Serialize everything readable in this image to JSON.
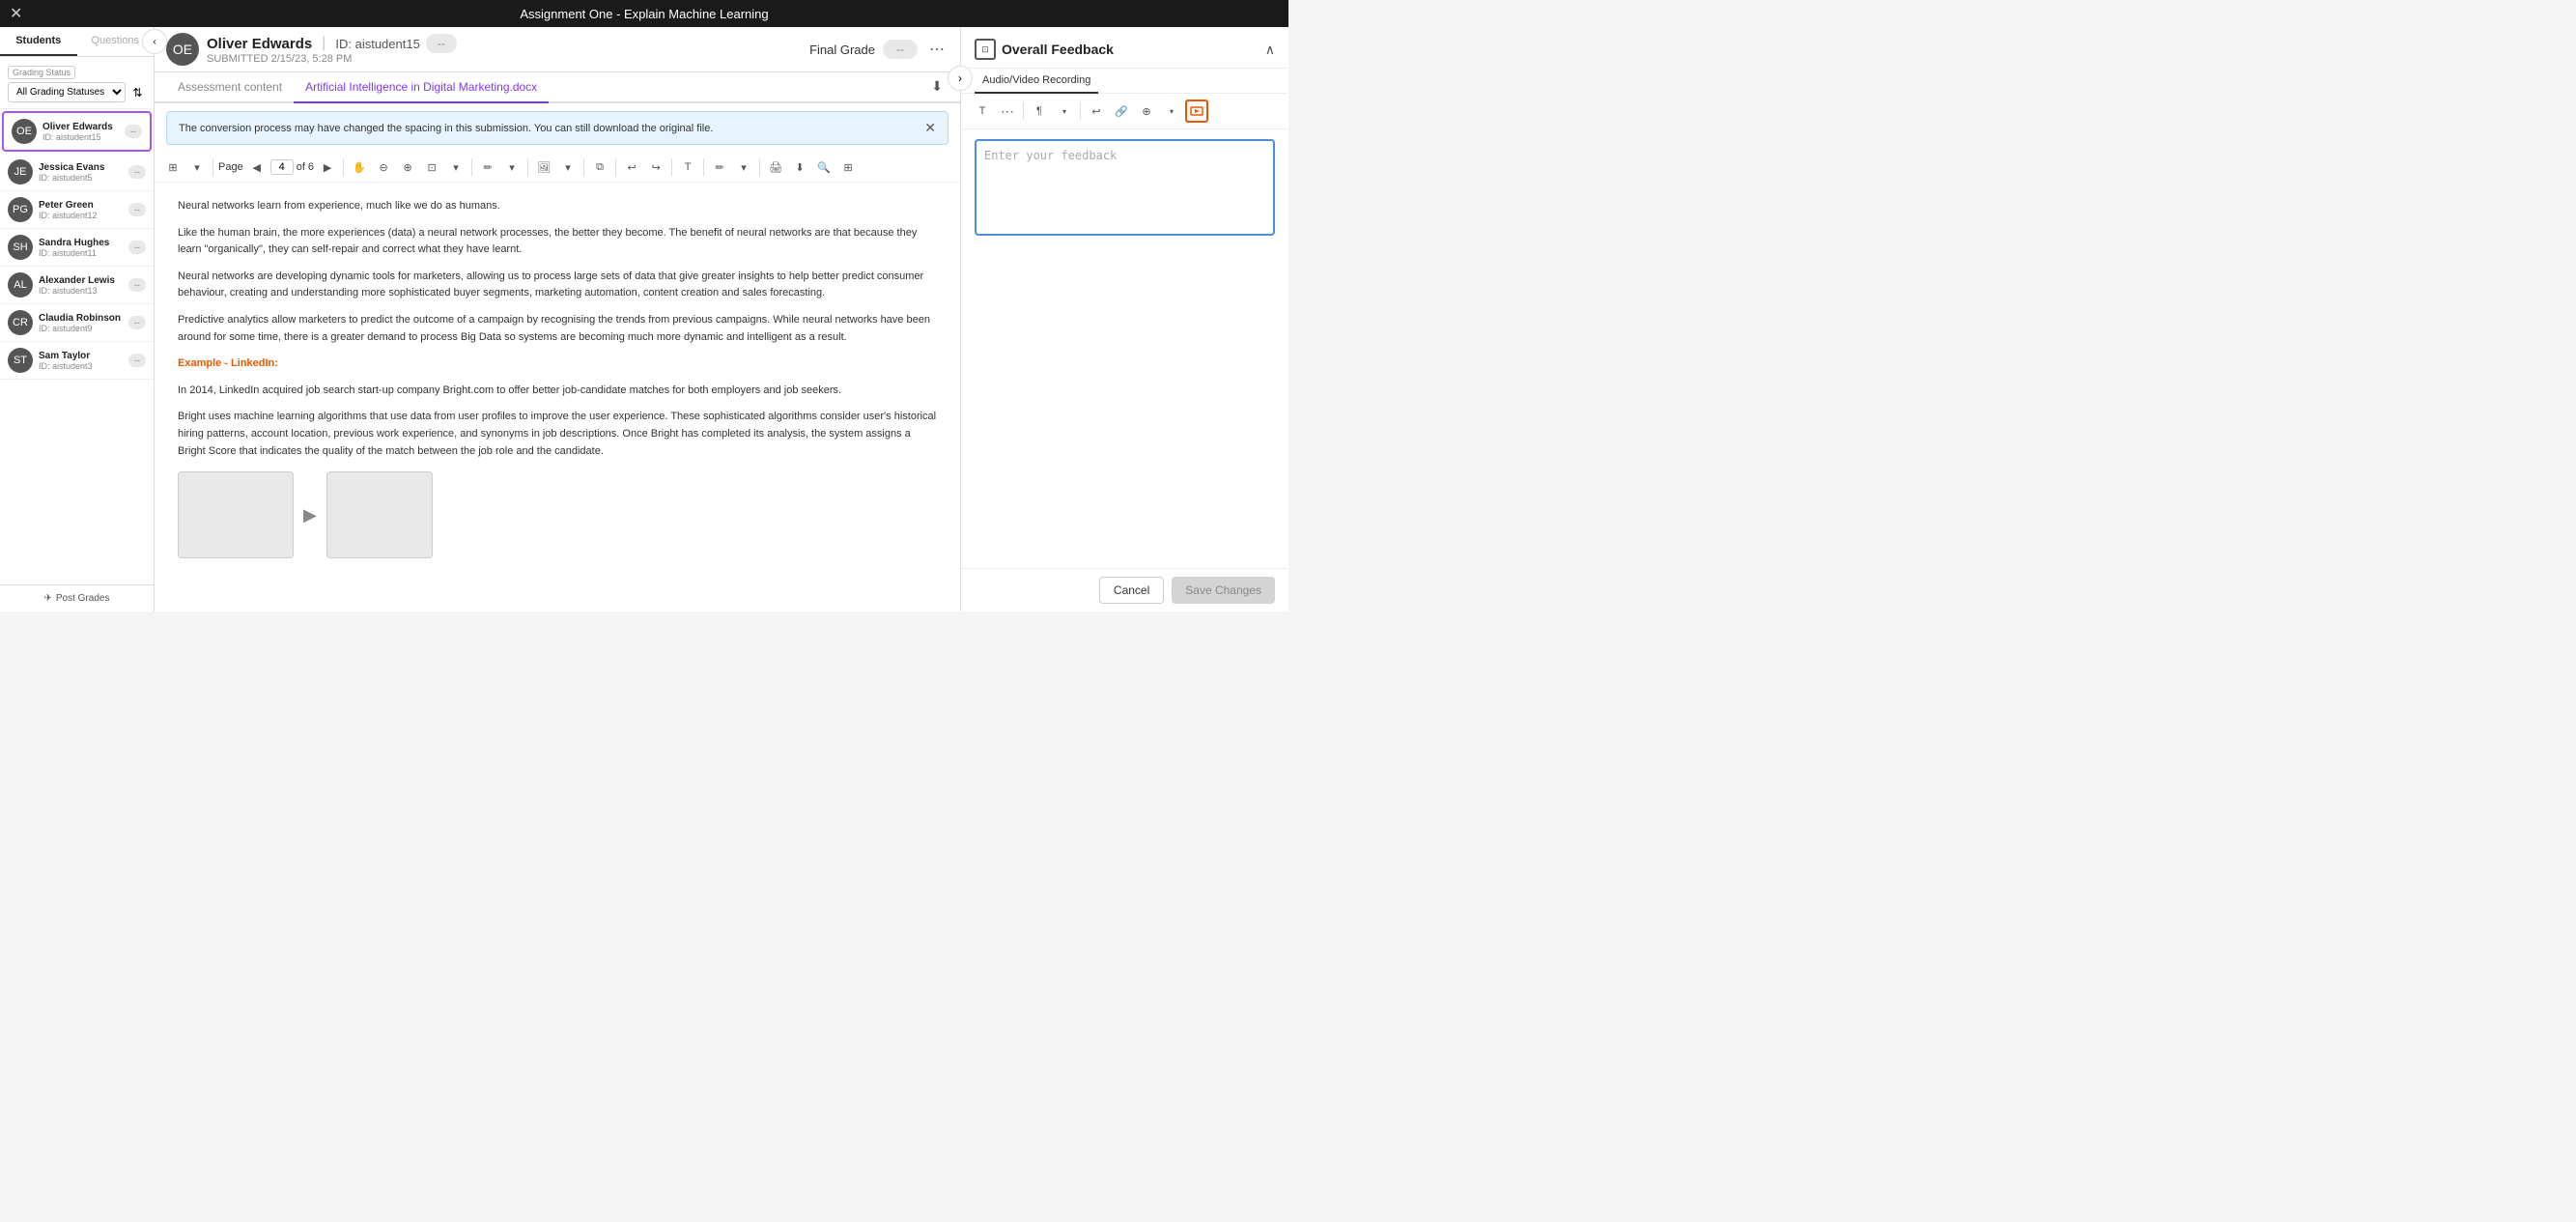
{
  "topBar": {
    "title": "Assignment One - Explain Machine Learning",
    "closeLabel": "✕"
  },
  "sidebar": {
    "tabs": [
      {
        "label": "Students",
        "active": true
      },
      {
        "label": "Questions",
        "active": false
      }
    ],
    "collapseBtn": "‹",
    "gradingStatusLabel": "Grading Status",
    "gradingStatusValue": "All Grading Statuses",
    "sortBtn": "⇅",
    "students": [
      {
        "name": "Oliver Edwards",
        "id": "aistudent15",
        "grade": "--",
        "active": true
      },
      {
        "name": "Jessica Evans",
        "id": "aistudent5",
        "grade": "--",
        "active": false
      },
      {
        "name": "Peter Green",
        "id": "aistudent12",
        "grade": "--",
        "active": false
      },
      {
        "name": "Sandra Hughes",
        "id": "aistudent11",
        "grade": "--",
        "active": false
      },
      {
        "name": "Alexander Lewis",
        "id": "aistudent13",
        "grade": "--",
        "active": false
      },
      {
        "name": "Claudia Robinson",
        "id": "aistudent9",
        "grade": "--",
        "active": false
      },
      {
        "name": "Sam Taylor",
        "id": "aistudent3",
        "grade": "--",
        "active": false
      }
    ],
    "postGrades": "Post Grades"
  },
  "header": {
    "studentName": "Oliver Edwards",
    "studentId": "ID: aistudent15",
    "submitted": "SUBMITTED 2/15/23, 5:28 PM",
    "scoreBadge": "--",
    "finalGradeLabel": "Final Grade",
    "finalGradeBadge": "--"
  },
  "contentTabs": [
    {
      "label": "Assessment content",
      "active": false
    },
    {
      "label": "Artificial Intelligence in Digital Marketing.docx",
      "active": true
    }
  ],
  "banner": {
    "text": "The conversion process may have changed the spacing in this submission. You can still download the original file.",
    "closeBtn": "✕"
  },
  "toolbar": {
    "pageLabel": "Page",
    "currentPage": "4",
    "pageOf": "of 6"
  },
  "document": {
    "paragraphs": [
      "Neural networks learn from experience, much like we do as humans.",
      "Like the human brain, the more experiences (data) a neural network processes, the better they become. The benefit of neural networks are that because they learn \"organically\", they can self-repair and correct what they have learnt.",
      "Neural networks are developing dynamic tools for marketers, allowing us to process large sets of data that give greater insights to help better predict consumer behaviour, creating and understanding more sophisticated buyer segments, marketing automation, content creation and sales forecasting.",
      "Predictive analytics allow marketers to predict the outcome of a campaign by recognising the trends from previous campaigns. While neural networks have been around for some time, there is a greater demand to process Big Data so systems are becoming much more dynamic and intelligent as a result."
    ],
    "exampleHeading": "Example - LinkedIn:",
    "exampleParagraph1": "In 2014, LinkedIn acquired job search start-up company Bright.com to offer better job-candidate matches for both employers and job seekers.",
    "exampleParagraph2": "Bright uses machine learning algorithms that use data from user profiles to improve the user experience. These sophisticated algorithms consider user's historical hiring patterns, account location, previous work experience, and synonyms in job descriptions. Once Bright has completed its analysis, the system assigns a Bright Score that indicates the quality of the match between the job role and the candidate."
  },
  "rightPanel": {
    "headerIcon": "⊡",
    "title": "Overall Feedback",
    "collapseBtn": "∧",
    "tabs": [
      {
        "label": "Audio/Video Recording",
        "active": true
      }
    ],
    "toolbarButtons": [
      {
        "label": "T",
        "icon": "text-format-icon"
      },
      {
        "label": "⋯",
        "icon": "more-format-icon"
      },
      {
        "label": "¶",
        "icon": "paragraph-icon"
      },
      {
        "label": "↩",
        "icon": "undo-icon"
      },
      {
        "label": "🔗",
        "icon": "link-icon"
      },
      {
        "label": "⊕",
        "icon": "emoji-icon"
      },
      {
        "label": "🎬",
        "icon": "media-icon",
        "highlighted": true
      }
    ],
    "feedbackPlaceholder": "Enter your feedback",
    "cancelBtn": "Cancel",
    "saveBtn": "Save Changes"
  }
}
